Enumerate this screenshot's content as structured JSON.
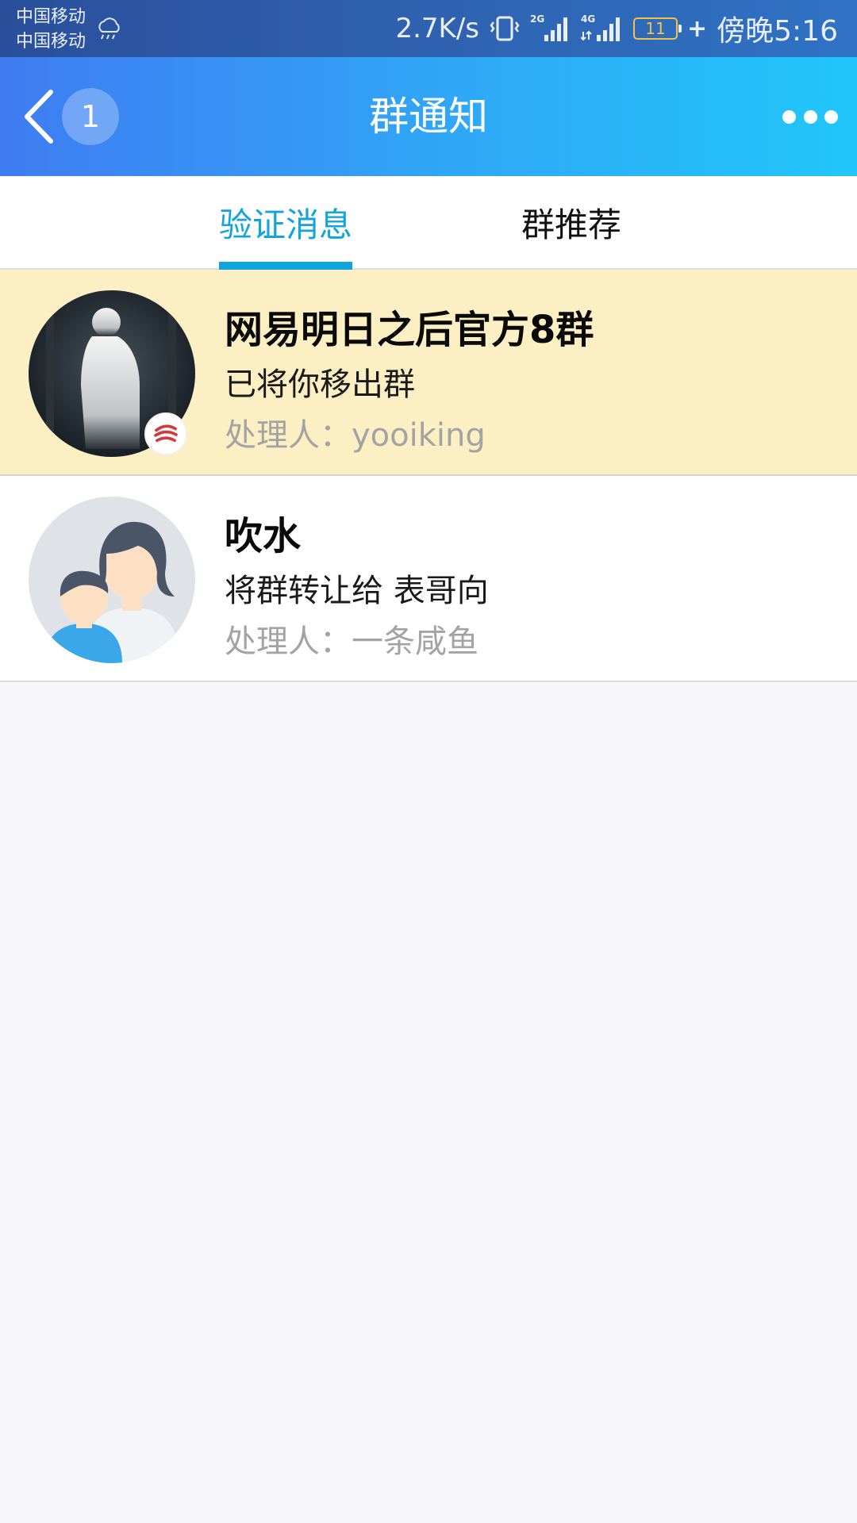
{
  "statusbar": {
    "carrier_1": "中国移动",
    "carrier_2": "中国移动",
    "net_speed": "2.7K/s",
    "net_2g": "2G",
    "net_4g": "4G",
    "battery": "11",
    "time": "傍晚5:16"
  },
  "header": {
    "unread_count": "1",
    "title": "群通知"
  },
  "tabs": [
    {
      "label": "验证消息",
      "active": true
    },
    {
      "label": "群推荐",
      "active": false
    }
  ],
  "notices": [
    {
      "title": "网易明日之后官方8群",
      "desc": "已将你移出群",
      "handler": "处理人：yooiking",
      "highlighted": true
    },
    {
      "title": "吹水",
      "desc": "将群转让给 表哥向",
      "handler": "处理人：一条咸鱼",
      "highlighted": false
    }
  ],
  "colors": {
    "accent": "#12a4dc",
    "highlight_bg": "#fcefc4",
    "header_gradient_start": "#3f7cf2",
    "header_gradient_end": "#20c6fb"
  }
}
